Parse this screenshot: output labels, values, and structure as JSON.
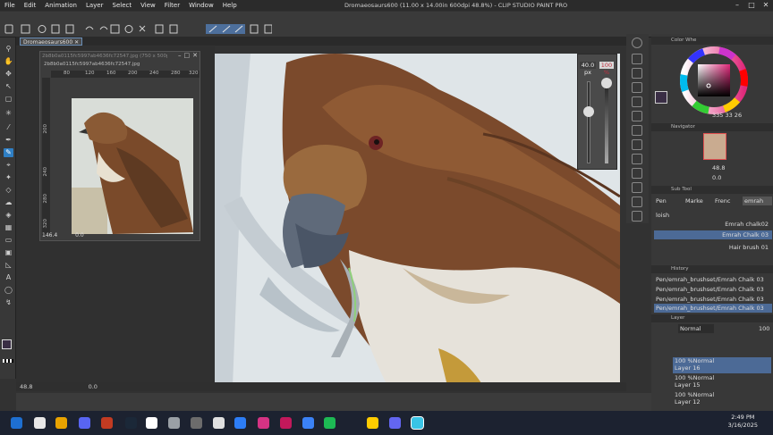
{
  "menu": [
    "File",
    "Edit",
    "Animation",
    "Layer",
    "Select",
    "View",
    "Filter",
    "Window",
    "Help"
  ],
  "window_title": "Dromaeosaurs600 (11.00 x 14.00in 600dpi 48.8%) - CLIP STUDIO PAINT PRO",
  "doc_tab": "Dromaeosaurs600",
  "sub_view": {
    "title": "2b8b0a0115fc5997ab4636fc72547.jpg (750 x 500px 96dpi 48.6%)",
    "filename": "2b8b0a0115fc5997ab4636fc72547.jpg",
    "ruler_top": [
      "80",
      "120",
      "160",
      "200",
      "240",
      "280",
      "320"
    ],
    "ruler_left": [
      "200",
      "240",
      "280",
      "320"
    ],
    "zoom": "146.4",
    "rotation": "0.0"
  },
  "brush_size": {
    "size": "40.0",
    "size_unit": "px",
    "opacity": "100",
    "opacity_unit": "%"
  },
  "color_wheel": {
    "title": "Color Whe",
    "values": "335  33  26",
    "main_color": "#3a2e45",
    "sub_color": "#ffffff"
  },
  "navigator": {
    "title": "Navigator",
    "zoom": "48.8",
    "rotation": "0.0"
  },
  "sub_tool": {
    "title": "Sub Tool",
    "tabs": [
      "Pen",
      "Marke",
      "Frenc",
      "emrah"
    ],
    "group": "loish",
    "brushes": [
      {
        "name": "Emrah chalk02",
        "selected": false
      },
      {
        "name": "Emrah Chalk 03",
        "selected": true
      },
      {
        "name": "Hair brush 01",
        "selected": false
      }
    ]
  },
  "history": {
    "title": "History",
    "items": [
      {
        "text": "Pen/emrah_brushset/Emrah Chalk 03",
        "selected": false
      },
      {
        "text": "Pen/emrah_brushset/Emrah Chalk 03",
        "selected": false
      },
      {
        "text": "Pen/emrah_brushset/Emrah Chalk 03",
        "selected": false
      },
      {
        "text": "Pen/emrah_brushset/Emrah Chalk 03",
        "selected": true
      }
    ]
  },
  "layer": {
    "title": "Layer",
    "blend_mode": "Normal",
    "opacity": "100",
    "items": [
      {
        "mode": "100 %Normal",
        "name": "Layer 16",
        "selected": true
      },
      {
        "mode": "100 %Normal",
        "name": "Layer 15",
        "selected": false
      },
      {
        "mode": "100 %Normal",
        "name": "Layer 12",
        "selected": false
      }
    ]
  },
  "status": {
    "zoom": "48.8",
    "rotation": "0.0"
  },
  "taskbar": {
    "time": "2:49 PM",
    "date": "3/16/2025",
    "app_colors": [
      "#1e6fd1",
      "#e8e8e8",
      "#e9a300",
      "#5865f2",
      "#c23b22",
      "#1b2838",
      "#ffffff",
      "#9aa0a6",
      "#6c6c6c",
      "#e0e0e0",
      "#2d7df6",
      "#d63384",
      "#c2185b",
      "#3b82f6",
      "#1db954",
      "#ffcc00",
      "#6366f1",
      "#39c4e6"
    ]
  }
}
